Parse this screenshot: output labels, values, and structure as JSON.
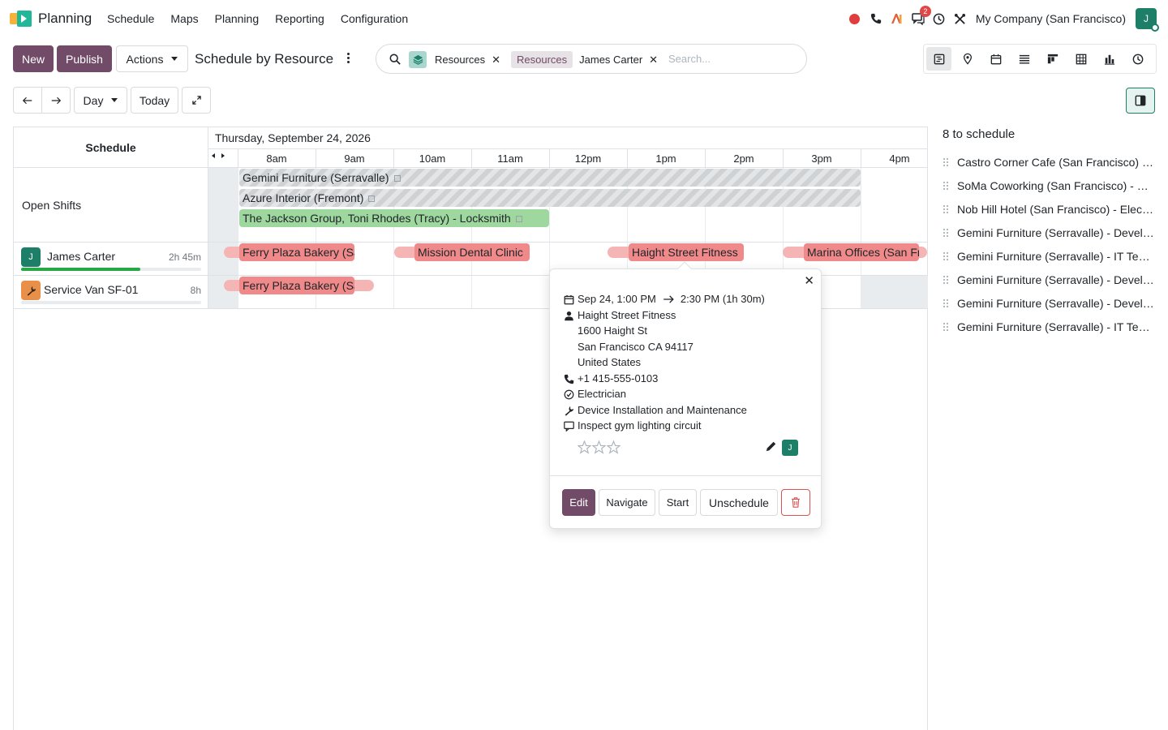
{
  "app": {
    "name": "Planning"
  },
  "menu": [
    "Schedule",
    "Maps",
    "Planning",
    "Reporting",
    "Configuration"
  ],
  "tray": {
    "chat_badge": "2",
    "company": "My Company (San Francisco)",
    "user_initial": "J"
  },
  "toolbar": {
    "new_label": "New",
    "publish_label": "Publish",
    "actions_label": "Actions",
    "view_title": "Schedule by Resource"
  },
  "search": {
    "facet1_value": "Resources",
    "facet2_label": "Resources",
    "facet2_value": "James Carter",
    "placeholder": "Search..."
  },
  "nav": {
    "scale_label": "Day",
    "today_label": "Today"
  },
  "gantt": {
    "header_label": "Schedule",
    "date_label": "Thursday, September 24, 2026",
    "hours": [
      "8am",
      "9am",
      "10am",
      "11am",
      "12pm",
      "1pm",
      "2pm",
      "3pm",
      "4pm"
    ],
    "open_shifts_label": "Open Shifts",
    "open_shifts": [
      "Gemini Furniture (Serravalle)",
      "Azure Interior (Fremont)",
      "The Jackson Group, Toni Rhodes (Tracy) - Locksmith"
    ],
    "resources": [
      {
        "name": "James Carter",
        "initial": "J",
        "hours": "2h 45m",
        "progress": 0.66,
        "color": "#1e7f69"
      },
      {
        "name": "Service Van SF-01",
        "initial": "",
        "hours": "8h",
        "progress": 0,
        "color": "#e8904a"
      }
    ],
    "james_shifts": [
      "Ferry Plaza Bakery (San Francisco)",
      "Mission Dental Clinic",
      "Haight Street Fitness",
      "Marina Offices (San Francisco)"
    ],
    "van_shifts": [
      "Ferry Plaza Bakery (San Francisco)"
    ]
  },
  "popover": {
    "start": "Sep 24, 1:00 PM",
    "end": "2:30 PM (1h 30m)",
    "customer": "Haight Street Fitness",
    "address_line1": "1600 Haight St",
    "address_line2": "San Francisco CA 94117",
    "address_line3": "United States",
    "phone": "+1 415-555-0103",
    "role": "Electrician",
    "service": "Device Installation and Maintenance",
    "note": "Inspect gym lighting circuit",
    "rating": 0,
    "assignee_initial": "J",
    "edit_label": "Edit",
    "navigate_label": "Navigate",
    "start_label": "Start",
    "unschedule_label": "Unschedule"
  },
  "side_panel": {
    "title": "8 to schedule",
    "items": [
      "Castro Corner Cafe (San Francisco) - Locksmith",
      "SoMa Coworking (San Francisco) - Electrician",
      "Nob Hill Hotel (San Francisco) - Electrician",
      "Gemini Furniture (Serravalle) - Developer",
      "Gemini Furniture (Serravalle) - IT Technician",
      "Gemini Furniture (Serravalle) - Developer",
      "Gemini Furniture (Serravalle) - Developer",
      "Gemini Furniture (Serravalle) - IT Technician"
    ]
  },
  "colors": {
    "brand": "#714b67",
    "accent": "#1e7f69",
    "shift_red": "#f08a8a",
    "shift_green": "#9ed89f"
  }
}
